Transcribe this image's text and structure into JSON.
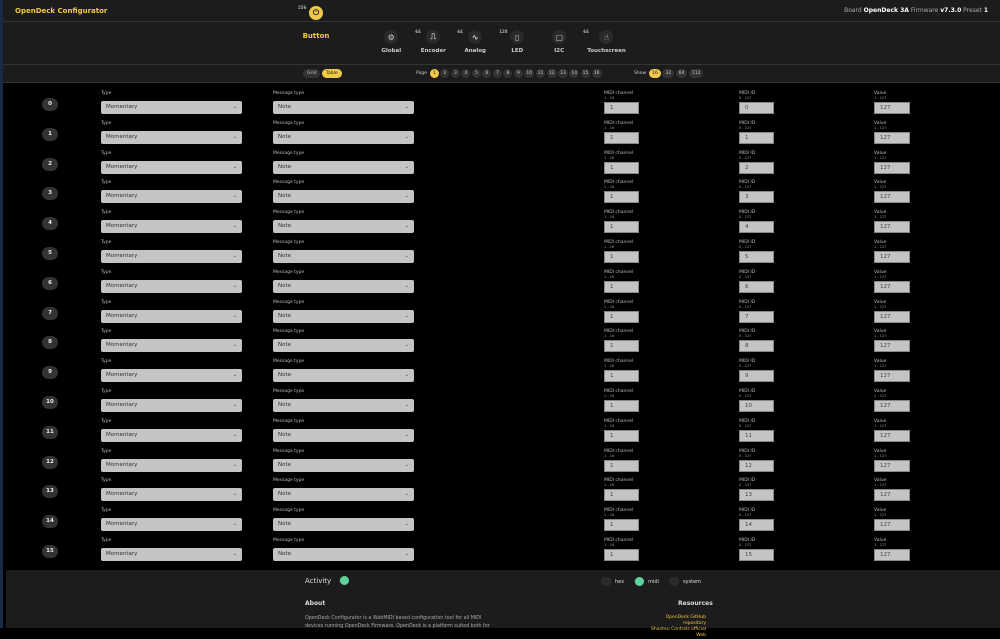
{
  "header": {
    "brand": "OpenDeck Configurator",
    "board_label": "Board",
    "board": "OpenDeck 3A",
    "firmware_label": "Firmware",
    "firmware": "v7.3.0",
    "preset_label": "Preset",
    "preset": "1"
  },
  "nav": [
    {
      "label": "Global",
      "icon": "gears-icon",
      "count": ""
    },
    {
      "label": "Button",
      "icon": "button-icon",
      "count": "256",
      "active": true
    },
    {
      "label": "Encoder",
      "icon": "encoder-icon",
      "count": "64"
    },
    {
      "label": "Analog",
      "icon": "analog-icon",
      "count": "64"
    },
    {
      "label": "LED",
      "icon": "led-icon",
      "count": "128"
    },
    {
      "label": "I2C",
      "icon": "i2c-icon",
      "count": ""
    },
    {
      "label": "Touchscreen",
      "icon": "touchscreen-icon",
      "count": "64"
    }
  ],
  "toolbar": {
    "views": [
      "Grid",
      "Table"
    ],
    "active_view": "Table",
    "page_label": "Page",
    "pages": [
      "1",
      "2",
      "3",
      "4",
      "5",
      "6",
      "7",
      "8",
      "9",
      "10",
      "11",
      "12",
      "13",
      "14",
      "15",
      "16"
    ],
    "active_page": "1",
    "show_label": "Show",
    "show_options": [
      "16",
      "32",
      "64",
      "112"
    ],
    "active_show": "16"
  },
  "fields": {
    "type_label": "Type",
    "msg_label": "Message type",
    "ch_label": "MIDI channel",
    "ch_range": "1 - 16",
    "id_label": "MIDI ID",
    "id_range": "0 - 127",
    "val_label": "Value",
    "val_range": "1 - 127"
  },
  "rows": [
    {
      "n": "0",
      "type": "Momentary",
      "msg": "Note",
      "ch": "1",
      "id": "0",
      "val": "127"
    },
    {
      "n": "1",
      "type": "Momentary",
      "msg": "Note",
      "ch": "1",
      "id": "1",
      "val": "127"
    },
    {
      "n": "2",
      "type": "Momentary",
      "msg": "Note",
      "ch": "1",
      "id": "2",
      "val": "127"
    },
    {
      "n": "3",
      "type": "Momentary",
      "msg": "Note",
      "ch": "1",
      "id": "3",
      "val": "127"
    },
    {
      "n": "4",
      "type": "Momentary",
      "msg": "Note",
      "ch": "1",
      "id": "4",
      "val": "127"
    },
    {
      "n": "5",
      "type": "Momentary",
      "msg": "Note",
      "ch": "1",
      "id": "5",
      "val": "127"
    },
    {
      "n": "6",
      "type": "Momentary",
      "msg": "Note",
      "ch": "1",
      "id": "6",
      "val": "127"
    },
    {
      "n": "7",
      "type": "Momentary",
      "msg": "Note",
      "ch": "1",
      "id": "7",
      "val": "127"
    },
    {
      "n": "8",
      "type": "Momentary",
      "msg": "Note",
      "ch": "1",
      "id": "8",
      "val": "127"
    },
    {
      "n": "9",
      "type": "Momentary",
      "msg": "Note",
      "ch": "1",
      "id": "9",
      "val": "127"
    },
    {
      "n": "10",
      "type": "Momentary",
      "msg": "Note",
      "ch": "1",
      "id": "10",
      "val": "127"
    },
    {
      "n": "11",
      "type": "Momentary",
      "msg": "Note",
      "ch": "1",
      "id": "11",
      "val": "127"
    },
    {
      "n": "12",
      "type": "Momentary",
      "msg": "Note",
      "ch": "1",
      "id": "12",
      "val": "127"
    },
    {
      "n": "13",
      "type": "Momentary",
      "msg": "Note",
      "ch": "1",
      "id": "13",
      "val": "127"
    },
    {
      "n": "14",
      "type": "Momentary",
      "msg": "Note",
      "ch": "1",
      "id": "14",
      "val": "127"
    },
    {
      "n": "15",
      "type": "Momentary",
      "msg": "Note",
      "ch": "1",
      "id": "15",
      "val": "127"
    }
  ],
  "footer": {
    "activity": "Activity",
    "activity_on": true,
    "filters": [
      {
        "label": "hex",
        "on": false
      },
      {
        "label": "midi",
        "on": true
      },
      {
        "label": "system",
        "on": false
      }
    ],
    "about_title": "About",
    "about_text": "OpenDeck Configurator is a WebMIDI based configuration tool for all MIDI devices running OpenDeck Firmware. OpenDeck is a platform suited both for",
    "resources_title": "Resources",
    "links": [
      "OpenDeck GitHub repository",
      "Shanteu Controls official Web"
    ]
  },
  "colors": {
    "accent": "#f0c94a",
    "active_toggle": "#5fd39a"
  }
}
